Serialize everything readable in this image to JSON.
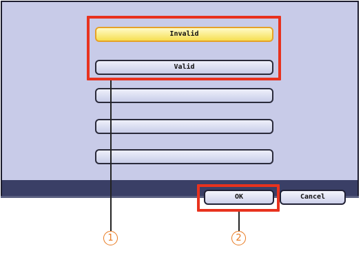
{
  "options": [
    {
      "label": "Invalid",
      "selected": true
    },
    {
      "label": "Valid",
      "selected": false
    },
    {
      "label": "",
      "selected": false
    },
    {
      "label": "",
      "selected": false
    },
    {
      "label": "",
      "selected": false
    }
  ],
  "buttons": {
    "ok": "OK",
    "cancel": "Cancel"
  },
  "callouts": {
    "first": "1",
    "second": "2"
  },
  "colors": {
    "highlight": "#e8321e",
    "selected_option": "#f6df52",
    "panel": "#c8cbe8",
    "bottom_bar": "#3a3f66",
    "callout": "#e8781e"
  }
}
